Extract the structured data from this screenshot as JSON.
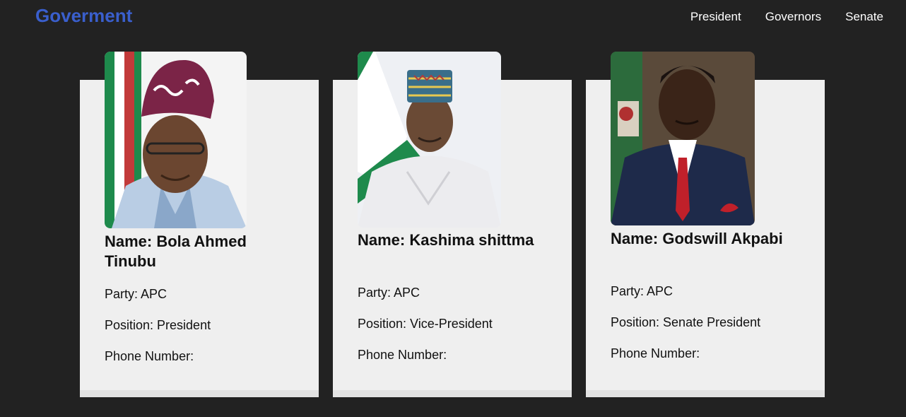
{
  "navbar": {
    "brand": "Goverment",
    "links": [
      "President",
      "Governors",
      "Senate"
    ]
  },
  "cards": [
    {
      "name": "Name: Bola Ahmed Tinubu",
      "party": "Party: APC",
      "position": "Position: President",
      "phone": "Phone Number:"
    },
    {
      "name": "Name: Kashima shittma",
      "party": "Party: APC",
      "position": "Position: Vice-President",
      "phone": "Phone Number:"
    },
    {
      "name": "Name: Godswill Akpabi",
      "party": "Party: APC",
      "position": "Position: Senate President",
      "phone": "Phone Number:"
    }
  ],
  "colors": {
    "page_background": "#222222",
    "brand": "#3a5fcd",
    "card_background": "#efefef",
    "nav_text": "#ffffff"
  }
}
